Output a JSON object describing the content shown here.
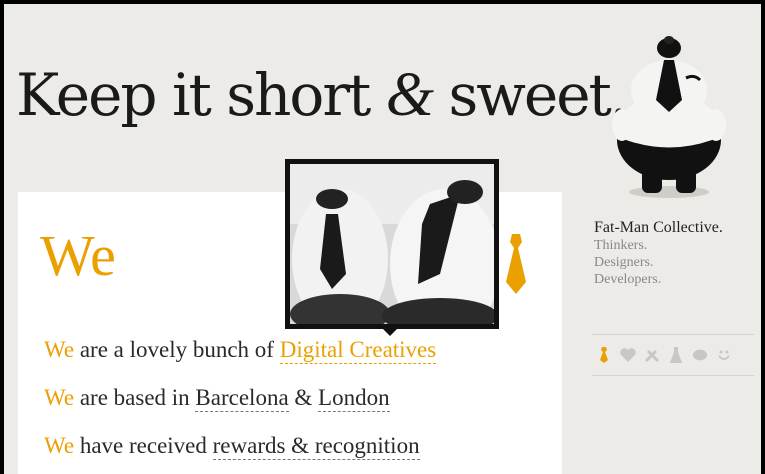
{
  "headline": {
    "part1": "Keep it short ",
    "amp": "&",
    "part2": " sweet."
  },
  "brand": {
    "title": "Fat-Man Collective.",
    "roles": [
      "Thinkers.",
      "Designers.",
      "Developers."
    ]
  },
  "icons": [
    "tie-icon",
    "heart-icon",
    "tools-icon",
    "flask-icon",
    "brain-icon",
    "smiley-icon"
  ],
  "colors": {
    "accent": "#eaa000",
    "background": "#ecebe8",
    "text": "#2a2a2a",
    "muted": "#888888"
  },
  "content": {
    "we_title": "We",
    "lines": [
      {
        "we": "We",
        "pre": " are a lovely bunch of ",
        "link1": "Digital Creatives",
        "mid": "",
        "link2": ""
      },
      {
        "we": "We",
        "pre": " are based in ",
        "link1": "Barcelona",
        "mid": " & ",
        "link2": "London"
      },
      {
        "we": "We",
        "pre": " have received ",
        "link1": "rewards & recognition",
        "mid": "",
        "link2": ""
      }
    ]
  }
}
